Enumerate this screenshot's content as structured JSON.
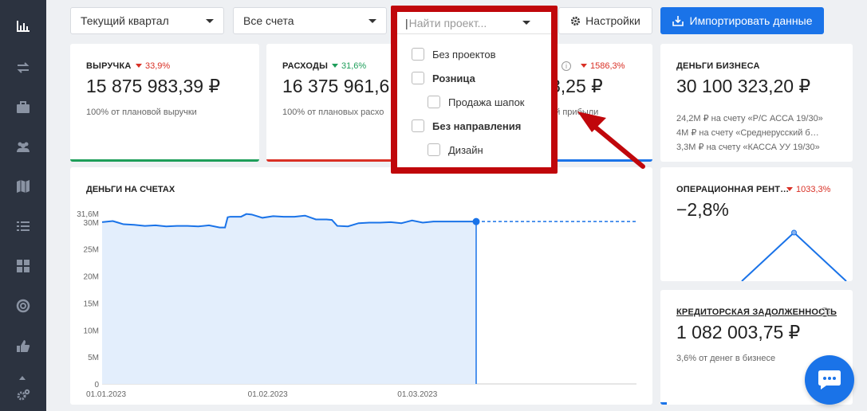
{
  "filters": {
    "period": "Текущий квартал",
    "accounts": "Все счета",
    "project_placeholder": "Найти проект...",
    "settings_label": "Настройки",
    "import_label": "Импортировать данные"
  },
  "kpis": {
    "revenue": {
      "title": "ВЫРУЧКА",
      "delta": "33,9%",
      "value": "15 875 983,39 ₽",
      "sub": "100% от плановой выручки"
    },
    "expenses": {
      "title": "РАСХОДЫ",
      "delta": "31,6%",
      "value": "16 375 961,6",
      "sub": "100% от плановых расхо"
    },
    "profit": {
      "delta": "1586,3%",
      "value": "8,25 ₽",
      "sub": "ой прибыли"
    },
    "business_money": {
      "title": "ДЕНЬГИ БИЗНЕСА",
      "value": "30 100 323,20 ₽",
      "lines": [
        "24,2М ₽ на счету «Р/С АССА 19/30»",
        "4М ₽ на счету «Среднерусский б…",
        "3,3М ₽ на счету «КАССА УУ 19/30»"
      ]
    },
    "op_profit": {
      "title": "ОПЕРАЦИОННАЯ РЕНТ…",
      "delta": "1033,3%",
      "value": "−2,8%"
    },
    "payables": {
      "title": "КРЕДИТОРСКАЯ ЗАДОЛЖЕННОСТЬ",
      "value": "1 082 003,75 ₽",
      "sub": "3,6% от денег в бизнесе"
    }
  },
  "dropdown": {
    "items": [
      {
        "label": "Без проектов",
        "bold": false
      },
      {
        "label": "Розница",
        "bold": true
      },
      {
        "label": "Продажа шапок",
        "bold": false
      },
      {
        "label": "Без направления",
        "bold": true
      },
      {
        "label": "Дизайн",
        "bold": false
      }
    ]
  },
  "colors": {
    "accent": "#1a73e8",
    "green": "#1e9e5a",
    "red": "#d93025",
    "annotation": "#c0070b"
  },
  "chart_data": {
    "type": "area",
    "title": "ДЕНЬГИ НА СЧЕТАХ",
    "x_ticks": [
      "01.01.2023",
      "01.02.2023",
      "01.03.2023"
    ],
    "y_ticks": [
      "0",
      "5M",
      "10M",
      "15M",
      "20M",
      "25M",
      "30M",
      "31,6M"
    ],
    "y_tick_values": [
      0,
      5,
      10,
      15,
      20,
      25,
      30,
      31.6
    ],
    "ylim": [
      0,
      31.6
    ],
    "x_range_days": [
      0,
      100
    ],
    "series": [
      {
        "x": [
          0,
          2,
          3,
          4,
          6,
          8,
          10,
          12,
          14,
          16,
          18,
          20,
          22,
          23,
          23.5,
          24,
          26,
          27,
          28,
          30,
          32,
          34,
          36,
          38,
          40,
          42,
          43,
          44,
          46,
          48,
          50,
          52,
          54,
          56,
          58,
          60,
          62,
          64,
          66,
          68,
          70
        ],
        "values": [
          30.0,
          30.2,
          29.9,
          29.6,
          29.5,
          29.3,
          29.4,
          29.2,
          29.3,
          29.3,
          29.2,
          29.4,
          29.0,
          29.0,
          30.9,
          31.0,
          31.0,
          31.5,
          31.4,
          30.8,
          31.1,
          31.0,
          31.0,
          31.2,
          30.5,
          30.5,
          30.4,
          29.3,
          29.2,
          29.8,
          29.9,
          29.9,
          30.0,
          29.8,
          30.3,
          29.9,
          30.1,
          30.1,
          30.1,
          30.1,
          30.1
        ]
      }
    ],
    "forecast_x": [
      70,
      100
    ],
    "forecast_values": [
      30.1,
      30.1
    ],
    "marker_x": 70,
    "op_profit_spark": [
      0,
      1,
      0
    ]
  }
}
